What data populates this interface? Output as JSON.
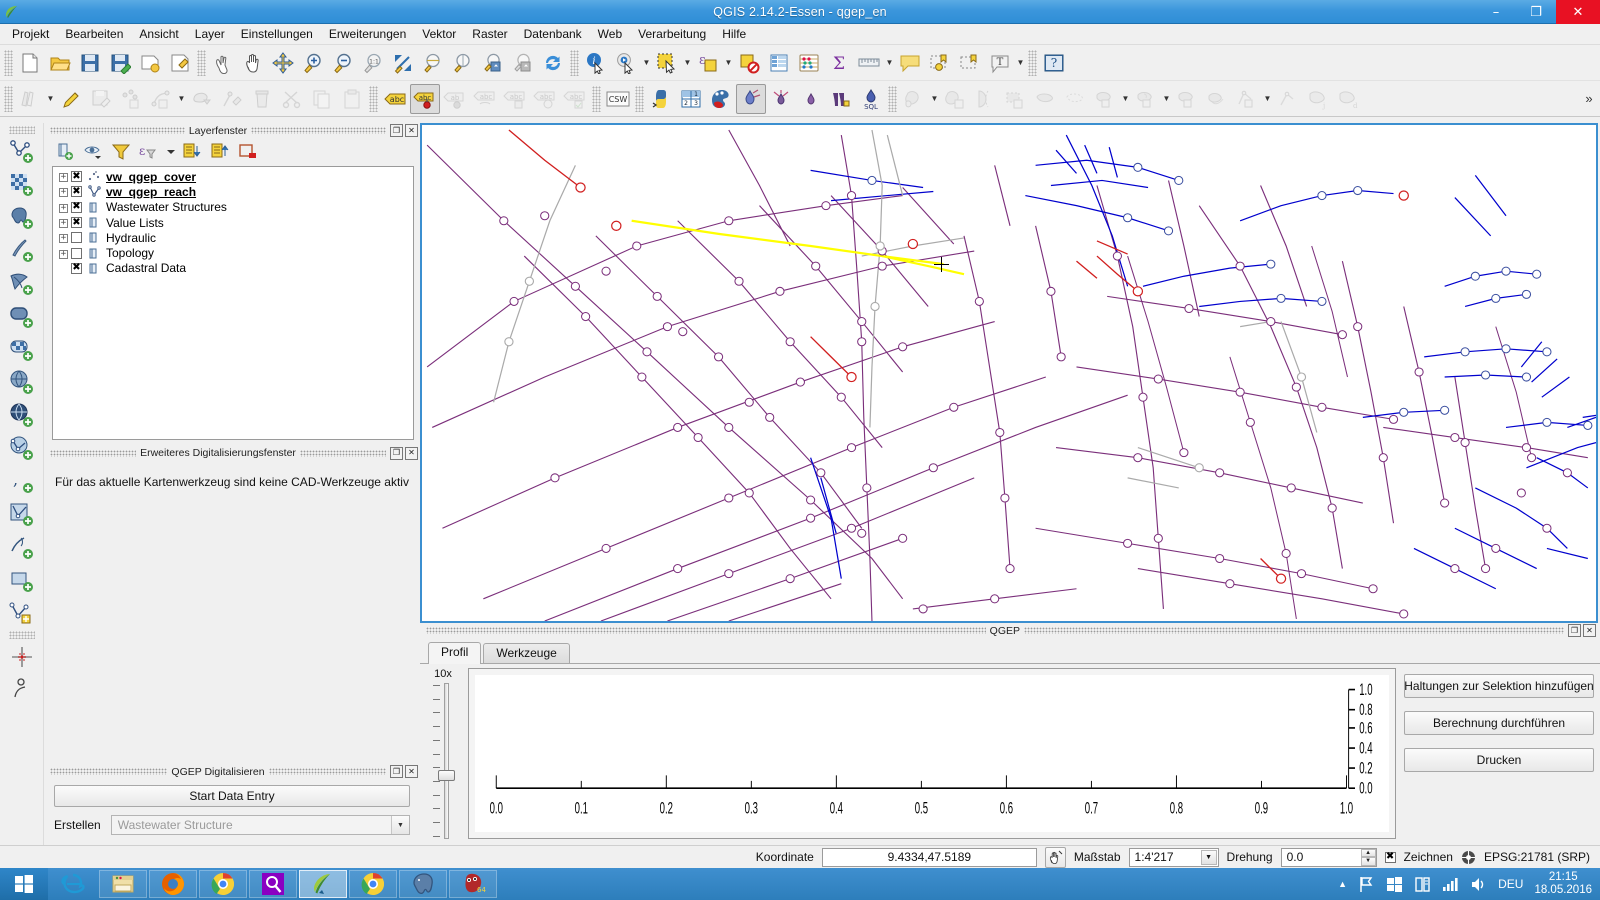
{
  "window": {
    "title": "QGIS 2.14.2-Essen - qgep_en",
    "logo_icon": "qgis-leaf-icon",
    "minimize_label": "–",
    "maximize_label": "❐",
    "close_label": "✕"
  },
  "menubar": {
    "items": [
      {
        "label": "Projekt"
      },
      {
        "label": "Bearbeiten"
      },
      {
        "label": "Ansicht"
      },
      {
        "label": "Layer"
      },
      {
        "label": "Einstellungen"
      },
      {
        "label": "Erweiterungen"
      },
      {
        "label": "Vektor"
      },
      {
        "label": "Raster"
      },
      {
        "label": "Datenbank"
      },
      {
        "label": "Web"
      },
      {
        "label": "Verarbeitung"
      },
      {
        "label": "Hilfe"
      }
    ]
  },
  "toolbar_main": {
    "overflow_label": "»",
    "items": [
      {
        "name": "new-project-icon"
      },
      {
        "name": "open-project-icon"
      },
      {
        "name": "save-project-icon"
      },
      {
        "name": "save-project-as-icon"
      },
      {
        "name": "new-print-composer-icon"
      },
      {
        "name": "composer-manager-icon"
      },
      {
        "name": "separator"
      },
      {
        "name": "touch-zoom-pan-icon"
      },
      {
        "name": "pan-map-icon"
      },
      {
        "name": "pan-to-selection-icon"
      },
      {
        "name": "zoom-in-icon"
      },
      {
        "name": "zoom-out-icon"
      },
      {
        "name": "zoom-native-icon"
      },
      {
        "name": "zoom-full-icon"
      },
      {
        "name": "zoom-to-layer-icon"
      },
      {
        "name": "zoom-to-selection-icon"
      },
      {
        "name": "zoom-last-icon"
      },
      {
        "name": "zoom-next-icon"
      },
      {
        "name": "refresh-icon"
      },
      {
        "name": "separator"
      },
      {
        "name": "identify-features-icon"
      },
      {
        "name": "run-feature-action-icon"
      },
      {
        "name": "select-features-icon"
      },
      {
        "name": "select-by-expression-icon"
      },
      {
        "name": "deselect-features-icon"
      },
      {
        "name": "open-attribute-table-icon"
      },
      {
        "name": "statistics-icon"
      },
      {
        "name": "field-calculator-icon"
      },
      {
        "name": "measure-icon"
      },
      {
        "name": "map-tips-icon"
      },
      {
        "name": "new-bookmark-icon"
      },
      {
        "name": "show-bookmarks-icon"
      },
      {
        "name": "text-annotation-icon"
      },
      {
        "name": "separator"
      },
      {
        "name": "help-icon"
      }
    ]
  },
  "toolbar_digitizing": {
    "items": [
      {
        "name": "current-edits-icon",
        "state": "disabled"
      },
      {
        "name": "toggle-editing-icon",
        "state": "enabled"
      },
      {
        "name": "save-layer-edits-icon",
        "state": "disabled"
      },
      {
        "name": "add-feature-point-icon",
        "state": "disabled"
      },
      {
        "name": "add-feature-line-icon",
        "state": "disabled"
      },
      {
        "name": "move-feature-icon",
        "state": "disabled"
      },
      {
        "name": "node-tool-icon",
        "state": "disabled"
      },
      {
        "name": "delete-selected-icon",
        "state": "disabled"
      },
      {
        "name": "cut-features-icon",
        "state": "disabled"
      },
      {
        "name": "copy-features-icon",
        "state": "disabled"
      },
      {
        "name": "paste-features-icon",
        "state": "disabled"
      },
      {
        "name": "separator"
      },
      {
        "name": "label-icon",
        "state": "enabled"
      },
      {
        "name": "pin-labels-icon",
        "state": "active"
      },
      {
        "name": "show-hide-labels-icon",
        "state": "disabled"
      },
      {
        "name": "move-label-icon",
        "state": "disabled"
      },
      {
        "name": "rotate-label-icon",
        "state": "disabled"
      },
      {
        "name": "change-label-icon",
        "state": "disabled"
      },
      {
        "name": "label-properties-icon",
        "state": "disabled"
      },
      {
        "name": "separator"
      },
      {
        "name": "csw-metasearch-icon",
        "state": "enabled"
      },
      {
        "name": "separator"
      },
      {
        "name": "python-console-icon",
        "state": "enabled"
      },
      {
        "name": "numerical-vertex-edit-icon",
        "state": "enabled"
      },
      {
        "name": "qgep-symbology-icon",
        "state": "enabled"
      },
      {
        "name": "qgep-profile-icon",
        "state": "active"
      },
      {
        "name": "qgep-downstream-icon",
        "state": "enabled"
      },
      {
        "name": "qgep-upstream-icon",
        "state": "enabled"
      },
      {
        "name": "qgep-wastewater-icon",
        "state": "enabled"
      },
      {
        "name": "qgep-sql-icon",
        "state": "enabled"
      },
      {
        "name": "separator"
      },
      {
        "name": "vector-geoprocessing-icon",
        "state": "disabled"
      },
      {
        "name": "vector-geometry-icon",
        "state": "disabled"
      },
      {
        "name": "split-features-icon",
        "state": "disabled"
      },
      {
        "name": "merge-features-icon",
        "state": "disabled"
      },
      {
        "name": "simplify-feature-icon",
        "state": "disabled"
      },
      {
        "name": "delete-ring-icon",
        "state": "disabled"
      },
      {
        "name": "add-part-icon",
        "state": "disabled"
      },
      {
        "name": "fill-ring-icon",
        "state": "disabled"
      },
      {
        "name": "add-ring-icon",
        "state": "disabled"
      },
      {
        "name": "reshape-features-icon",
        "state": "disabled"
      },
      {
        "name": "offset-curve-icon",
        "state": "disabled"
      },
      {
        "name": "trace-icon",
        "state": "disabled"
      },
      {
        "name": "rotate-point-icon",
        "state": "disabled"
      },
      {
        "name": "delete-part-icon",
        "state": "disabled"
      }
    ]
  },
  "toolbar_left_vertical": {
    "items": [
      {
        "name": "add-vector-layer-icon"
      },
      {
        "name": "add-raster-layer-icon"
      },
      {
        "name": "add-postgis-layer-icon"
      },
      {
        "name": "add-spatialite-layer-icon"
      },
      {
        "name": "add-mssql-layer-icon"
      },
      {
        "name": "add-oracle-layer-icon"
      },
      {
        "name": "add-db2-layer-icon"
      },
      {
        "name": "add-wms-layer-icon"
      },
      {
        "name": "add-wcs-layer-icon"
      },
      {
        "name": "add-wfs-layer-icon"
      },
      {
        "name": "add-delimited-text-layer-icon"
      },
      {
        "name": "add-virtual-layer-icon"
      },
      {
        "name": "new-shapefile-layer-icon"
      },
      {
        "name": "new-spatialite-layer-icon"
      },
      {
        "name": "new-gpx-layer-icon"
      },
      {
        "name": "separator"
      },
      {
        "name": "snapping-options-icon"
      },
      {
        "name": "measure-angle-icon"
      }
    ]
  },
  "layers_panel": {
    "title": "Layerfenster",
    "float_btn": "❐",
    "close_btn": "✕",
    "toolbar": [
      {
        "name": "add-group-icon"
      },
      {
        "name": "manage-visibility-icon"
      },
      {
        "name": "filter-legend-icon"
      },
      {
        "name": "filter-expression-icon"
      },
      {
        "name": "expand-all-icon"
      },
      {
        "name": "collapse-all-icon"
      },
      {
        "name": "remove-layer-icon"
      }
    ],
    "items": [
      {
        "label": "vw_qgep_cover",
        "checked": true,
        "bold": true,
        "icon": "point-layer-icon",
        "expandable": true
      },
      {
        "label": "vw_qgep_reach",
        "checked": true,
        "bold": true,
        "icon": "line-layer-icon",
        "expandable": true
      },
      {
        "label": "Wastewater Structures",
        "checked": true,
        "bold": false,
        "icon": "group-icon",
        "expandable": true
      },
      {
        "label": "Value Lists",
        "checked": true,
        "bold": false,
        "icon": "group-icon",
        "expandable": true
      },
      {
        "label": "Hydraulic",
        "checked": false,
        "bold": false,
        "icon": "group-icon",
        "expandable": true
      },
      {
        "label": "Topology",
        "checked": false,
        "bold": false,
        "icon": "group-icon",
        "expandable": true
      },
      {
        "label": "Cadastral Data",
        "checked": true,
        "bold": false,
        "icon": "group-icon",
        "expandable": false
      }
    ],
    "checkmark": "✖",
    "expander_glyph": "+"
  },
  "cad_panel": {
    "title": "Erweiteres Digitalisierungsfenster",
    "float_btn": "❐",
    "close_btn": "✕",
    "message": "Für das aktuelle Kartenwerkzeug sind keine CAD-Werkzeuge aktiv"
  },
  "qgep_digitize_panel": {
    "title": "QGEP Digitalisieren",
    "float_btn": "❐",
    "close_btn": "✕",
    "start_button": "Start Data Entry",
    "create_label": "Erstellen",
    "create_value": "Wastewater Structure",
    "dropdown_glyph": "▼"
  },
  "qgep_panel": {
    "title": "QGEP",
    "float_btn": "❐",
    "close_btn": "✕",
    "tabs": [
      {
        "label": "Profil",
        "active": true
      },
      {
        "label": "Werkzeuge",
        "active": false
      }
    ],
    "zoom_label": "10x",
    "buttons": [
      {
        "label": "Haltungen zur Selektion hinzufügen"
      },
      {
        "label": "Berechnung durchführen"
      },
      {
        "label": "Drucken"
      }
    ]
  },
  "chart_data": {
    "type": "line",
    "title": "",
    "xlabel": "",
    "ylabel": "",
    "x_ticks": [
      "0.0",
      "0.1",
      "0.2",
      "0.3",
      "0.4",
      "0.5",
      "0.6",
      "0.7",
      "0.8",
      "0.9",
      "1.0"
    ],
    "y_ticks": [
      "0.0",
      "0.2",
      "0.4",
      "0.6",
      "0.8",
      "1.0"
    ],
    "xlim": [
      0.0,
      1.0
    ],
    "ylim": [
      0.0,
      1.0
    ],
    "series": [],
    "grid": false,
    "legend": false,
    "y_axis_position": "right"
  },
  "statusbar": {
    "coordinate_label": "Koordinate",
    "coordinate_value": "9.4334,47.5189",
    "toggle_extents_icon": "coordinate-capture-icon",
    "scale_label": "Maßstab",
    "scale_value": "1:4'217",
    "rotation_label": "Drehung",
    "rotation_value": "0.0",
    "render_label": "Zeichnen",
    "render_checked": "✖",
    "crs_label": "EPSG:21781 (SRP)",
    "crs_icon": "crs-globe-icon"
  },
  "map": {
    "accent_selection": "#ffff00",
    "reach_color": "#800080",
    "blue_color": "#0000cd",
    "grey_color": "#a0a0a0",
    "red_color": "#d11f1f",
    "cursor": "crosshair-cursor"
  },
  "taskbar": {
    "start_icon": "windows-start-icon",
    "tasks": [
      {
        "name": "internet-explorer-icon",
        "pinned": true,
        "selected": false
      },
      {
        "name": "file-explorer-icon",
        "pinned": false,
        "selected": false
      },
      {
        "name": "firefox-icon",
        "pinned": false,
        "selected": false
      },
      {
        "name": "chrome-icon",
        "pinned": false,
        "selected": false
      },
      {
        "name": "search-everything-icon",
        "pinned": false,
        "selected": false
      },
      {
        "name": "qgis-icon",
        "pinned": false,
        "selected": true
      },
      {
        "name": "chrome-2-icon",
        "pinned": false,
        "selected": false
      },
      {
        "name": "postgresql-icon",
        "pinned": false,
        "selected": false
      },
      {
        "name": "gimp-icon",
        "pinned": false,
        "selected": false,
        "badge": "64"
      }
    ],
    "tray": {
      "expand_glyph": "▲",
      "icons": [
        "flag-icon",
        "windows-action-center-icon",
        "network-drive-icon",
        "signal-icon",
        "volume-icon"
      ],
      "language": "DEU",
      "time": "21:15",
      "date": "18.05.2016"
    }
  }
}
